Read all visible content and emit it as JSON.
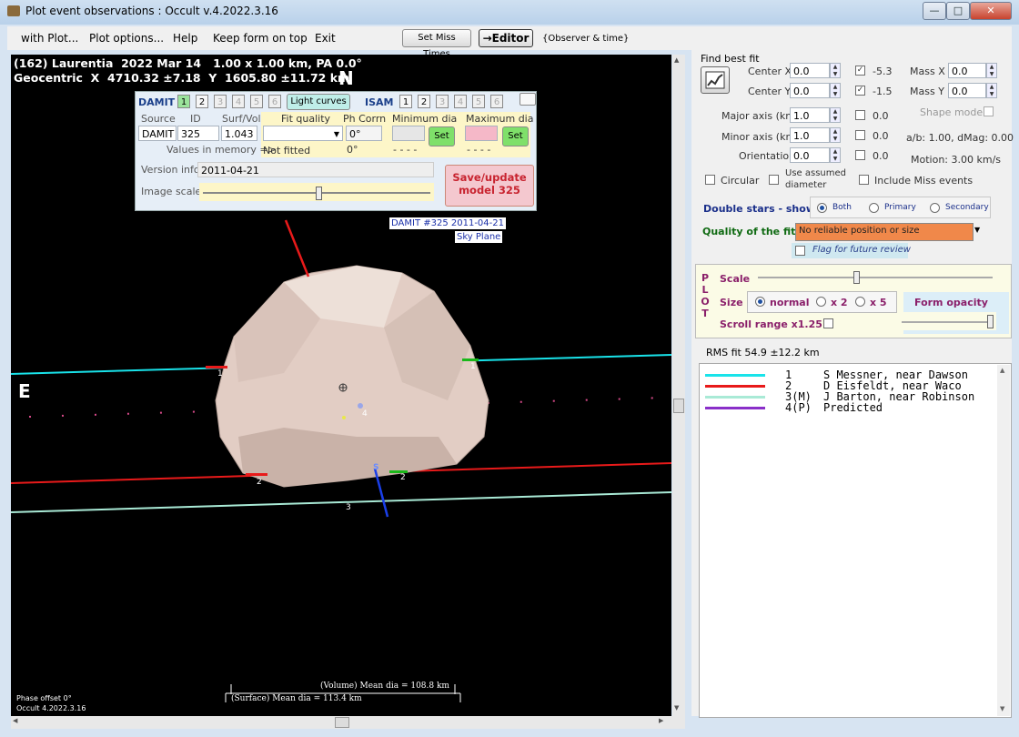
{
  "window": {
    "title": "Plot event observations : Occult v.4.2022.3.16",
    "minimize": "—",
    "maximize": "□",
    "close": "✕"
  },
  "menu": {
    "items": [
      "with Plot...",
      "Plot options...",
      "Help",
      "Keep form on top",
      "Exit"
    ],
    "set_miss_times": "Set Miss Times",
    "editor": "→Editor",
    "observer_time": "{Observer & time}"
  },
  "plot": {
    "header_line1": "(162) Laurentia  2022 Mar 14   1.00 x 1.00 km, PA 0.0°",
    "header_line2": "Geocentric  X  4710.32 ±7.18  Y  1605.80 ±11.72 km",
    "north": "N",
    "east": "E",
    "damit_tag_line1": "DAMIT #325 2011-04-21",
    "damit_tag_line2": "Sky Plane",
    "chord_labels": [
      "1",
      "1",
      "2",
      "2",
      "3",
      "4"
    ],
    "blue_marker": "S",
    "phase_offset": "Phase offset 0°",
    "version": "Occult 4.2022.3.16",
    "volume_dia": "(Volume) Mean dia = 108.8 km",
    "surface_dia": "(Surface) Mean dia = 113.4 km"
  },
  "damit_panel": {
    "damit_label": "DAMIT",
    "damit_buttons": [
      "1",
      "2",
      "3",
      "4",
      "5",
      "6"
    ],
    "light_curves": "Light curves",
    "isam_label": "ISAM",
    "isam_buttons": [
      "1",
      "2",
      "3",
      "4",
      "5",
      "6"
    ],
    "col_source": "Source",
    "col_id": "ID",
    "col_surfvol": "Surf/Vol",
    "col_fit": "Fit quality",
    "col_phcorrn": "Ph Corrn",
    "col_min": "Minimum dia",
    "col_max": "Maximum dia",
    "source_value": "DAMIT",
    "id_value": "325",
    "surfvol_value": "1.043",
    "phcorrn_value": "0°",
    "set_label": "Set",
    "values_in_memory": "Values in memory =>",
    "not_fitted": "Not fitted",
    "mem_phcorrn": "0°",
    "mem_min": "- - - -",
    "mem_max": "- - - -",
    "version_info_label": "Version info",
    "version_info_value": "2011-04-21",
    "image_scale_label": "Image scale",
    "save_line1": "Save/update",
    "save_line2": "model 325"
  },
  "fit": {
    "find_best_fit": "Find best fit",
    "center_x_label": "Center X",
    "center_x": "0.0",
    "center_x_check": "-5.3",
    "center_y_label": "Center Y",
    "center_y": "0.0",
    "center_y_check": "-1.5",
    "mass_x_label": "Mass X",
    "mass_x": "0.0",
    "mass_y_label": "Mass Y",
    "mass_y": "0.0",
    "major_label": "Major axis (km)",
    "major": "1.0",
    "major_check": "0.0",
    "minor_label": "Minor axis (km)",
    "minor": "1.0",
    "minor_check": "0.0",
    "orient_label": "Orientation",
    "orient": "0.0",
    "orient_check": "0.0",
    "shape_model": "Shape model",
    "ab_text": "a/b: 1.00, dMag: 0.00",
    "motion_text": "Motion: 3.00 km/s",
    "circular": "Circular",
    "use_assumed_1": "Use assumed",
    "use_assumed_2": "diameter",
    "include_miss": "Include Miss events",
    "double_stars": "Double stars - show",
    "radio_both": "Both",
    "radio_primary": "Primary",
    "radio_secondary": "Secondary",
    "quality_label": "Quality of the fit",
    "quality_value": "No reliable position or size",
    "flag_review": "Flag for future review"
  },
  "plot_box": {
    "vertical": [
      "P",
      "L",
      "O",
      "T"
    ],
    "scale": "Scale",
    "size": "Size",
    "size_normal": "normal",
    "size_x2": "x 2",
    "size_x5": "x 5",
    "form_opacity": "Form opacity",
    "scroll_range": "Scroll range x1.25"
  },
  "rms": "RMS fit 54.9 ±12.2 km",
  "legend": [
    {
      "num": "1   ",
      "text": "S Messner, near Dawson",
      "color": "#19e3ea"
    },
    {
      "num": "2   ",
      "text": "D Eisfeldt, near Waco",
      "color": "#e81a1a"
    },
    {
      "num": "3(M)",
      "text": "J Barton, near Robinson",
      "color": "#a9ead6"
    },
    {
      "num": "4(P)",
      "text": "Predicted",
      "color": "#8a2fc9"
    }
  ]
}
